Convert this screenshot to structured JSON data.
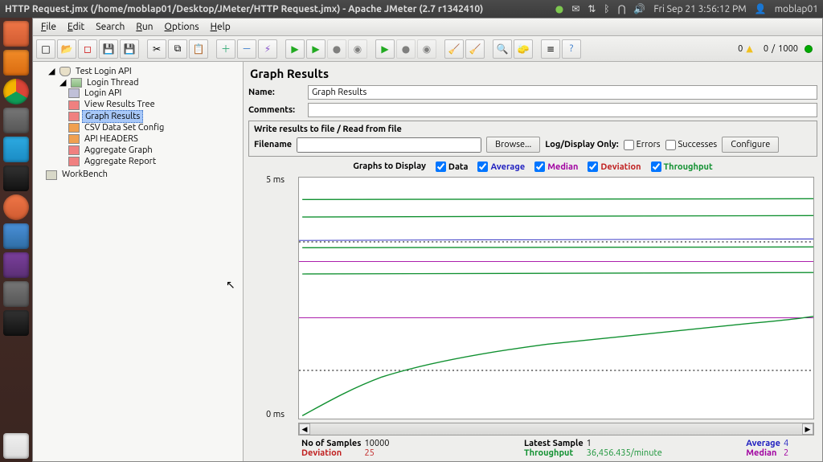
{
  "window_title": "HTTP Request.jmx (/home/moblap01/Desktop/JMeter/HTTP Request.jmx) - Apache JMeter (2.7 r1342410)",
  "system_tray": {
    "datetime": "Fri Sep 21 3:56:12 PM",
    "user": "moblap01"
  },
  "menubar": [
    "File",
    "Edit",
    "Search",
    "Run",
    "Options",
    "Help"
  ],
  "toolbar_counter": {
    "warnings": "0",
    "active": "0",
    "total": "1000"
  },
  "tree": {
    "root": "Test Login API",
    "thread_group": "Login Thread",
    "children": [
      "Login API",
      "View Results Tree",
      "Graph Results",
      "CSV Data Set Config",
      "API HEADERS",
      "Aggregate Graph",
      "Aggregate Report"
    ],
    "workbench": "WorkBench",
    "selected": "Graph Results"
  },
  "panel": {
    "title": "Graph Results",
    "name_label": "Name:",
    "name_value": "Graph Results",
    "comments_label": "Comments:",
    "file_section_title": "Write results to file / Read from file",
    "filename_label": "Filename",
    "filename_value": "",
    "browse_btn": "Browse...",
    "logdisplay_label": "Log/Display Only:",
    "errors_label": "Errors",
    "successes_label": "Successes",
    "configure_btn": "Configure",
    "graphs_label": "Graphs to Display",
    "g_data": "Data",
    "g_avg": "Average",
    "g_med": "Median",
    "g_dev": "Deviation",
    "g_thr": "Throughput"
  },
  "chart_data": {
    "type": "line",
    "ylabel_unit": "ms",
    "ylim": [
      0,
      5
    ],
    "y_ticks": [
      "0 ms",
      "5 ms"
    ],
    "x_range": [
      0,
      10000
    ],
    "series": [
      {
        "name": "Data",
        "color": "#000",
        "style": "scatter-band",
        "y_bands": [
          3.65,
          1.0
        ]
      },
      {
        "name": "Average",
        "color": "#2020c0",
        "style": "line",
        "y_approx": 3.7
      },
      {
        "name": "Median",
        "color": "#a000a0",
        "style": "line",
        "y_segments": [
          3.25,
          2.1
        ]
      },
      {
        "name": "Deviation",
        "color": "#c02020",
        "style": "line",
        "y_approx": 0.5
      },
      {
        "name": "Throughput",
        "color": "#109030",
        "style": "line-rising",
        "y_start": 0.05,
        "y_end": 2.2,
        "extra_flat_lines": [
          4.55,
          4.2,
          3.55,
          3.0
        ]
      }
    ]
  },
  "stats": {
    "no_samples_label": "No of Samples",
    "no_samples": "10000",
    "latest_label": "Latest Sample",
    "latest": "1",
    "average_label": "Average",
    "average": "4",
    "deviation_label": "Deviation",
    "deviation": "25",
    "throughput_label": "Throughput",
    "throughput": "36,456.435/minute",
    "median_label": "Median",
    "median": "2"
  }
}
